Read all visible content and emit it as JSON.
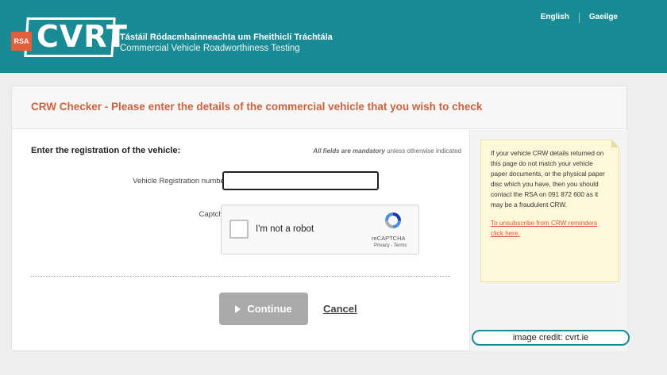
{
  "header": {
    "logo_text": "CVRT",
    "rsa_text": "RSA",
    "tagline_ga": "Tástáil Ródacmhainneachta um Fheithiclí Tráchtála",
    "tagline_en": "Commercial Vehicle Roadworthiness Testing",
    "languages": [
      "English",
      "Gaeilge"
    ]
  },
  "page": {
    "title": "CRW Checker - Please enter the details of the commercial vehicle that you wish to check"
  },
  "form": {
    "section_label": "Enter the registration of the vehicle:",
    "mandatory_bold": "All fields are mandatory",
    "mandatory_rest": " unless otherwise indicated",
    "reg_label": "Vehicle Registration number",
    "reg_value": "",
    "captcha_label": "Captcha",
    "continue_label": "Continue",
    "cancel_label": "Cancel"
  },
  "recaptcha": {
    "checkbox_label": "I'm not a robot",
    "brand": "reCAPTCHA",
    "links": "Privacy - Terms"
  },
  "note": {
    "text": "If your vehicle CRW details returned on this page do not match your vehicle paper documents, or the physical paper disc which you have, then you should contact the RSA on 091 872 600 as it may be a fraudulent CRW.",
    "link": "To unsubscribe from CRW reminders click here",
    "link_suffix": "."
  },
  "credit": "image credit: cvrt.ie",
  "colors": {
    "header": "#1a8a94",
    "title": "#c8623f",
    "rsa": "#e0603b",
    "note_bg": "#fdf8d9",
    "button": "#aaaaaa"
  }
}
